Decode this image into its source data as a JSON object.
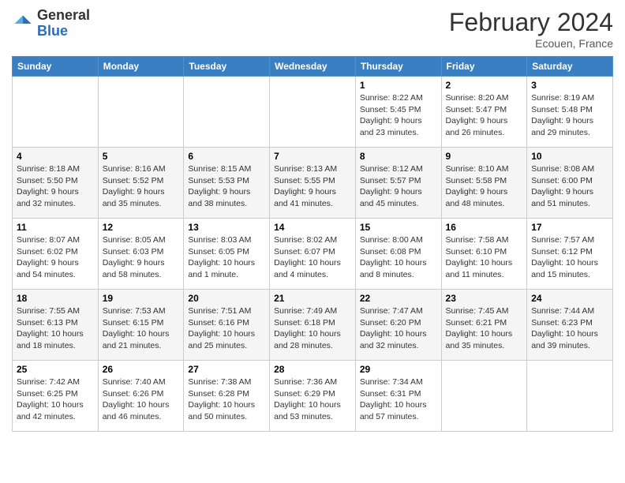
{
  "header": {
    "logo_general": "General",
    "logo_blue": "Blue",
    "month_title": "February 2024",
    "location": "Ecouen, France"
  },
  "days_of_week": [
    "Sunday",
    "Monday",
    "Tuesday",
    "Wednesday",
    "Thursday",
    "Friday",
    "Saturday"
  ],
  "weeks": [
    [
      {
        "day": "",
        "info": ""
      },
      {
        "day": "",
        "info": ""
      },
      {
        "day": "",
        "info": ""
      },
      {
        "day": "",
        "info": ""
      },
      {
        "day": "1",
        "info": "Sunrise: 8:22 AM\nSunset: 5:45 PM\nDaylight: 9 hours\nand 23 minutes."
      },
      {
        "day": "2",
        "info": "Sunrise: 8:20 AM\nSunset: 5:47 PM\nDaylight: 9 hours\nand 26 minutes."
      },
      {
        "day": "3",
        "info": "Sunrise: 8:19 AM\nSunset: 5:48 PM\nDaylight: 9 hours\nand 29 minutes."
      }
    ],
    [
      {
        "day": "4",
        "info": "Sunrise: 8:18 AM\nSunset: 5:50 PM\nDaylight: 9 hours\nand 32 minutes."
      },
      {
        "day": "5",
        "info": "Sunrise: 8:16 AM\nSunset: 5:52 PM\nDaylight: 9 hours\nand 35 minutes."
      },
      {
        "day": "6",
        "info": "Sunrise: 8:15 AM\nSunset: 5:53 PM\nDaylight: 9 hours\nand 38 minutes."
      },
      {
        "day": "7",
        "info": "Sunrise: 8:13 AM\nSunset: 5:55 PM\nDaylight: 9 hours\nand 41 minutes."
      },
      {
        "day": "8",
        "info": "Sunrise: 8:12 AM\nSunset: 5:57 PM\nDaylight: 9 hours\nand 45 minutes."
      },
      {
        "day": "9",
        "info": "Sunrise: 8:10 AM\nSunset: 5:58 PM\nDaylight: 9 hours\nand 48 minutes."
      },
      {
        "day": "10",
        "info": "Sunrise: 8:08 AM\nSunset: 6:00 PM\nDaylight: 9 hours\nand 51 minutes."
      }
    ],
    [
      {
        "day": "11",
        "info": "Sunrise: 8:07 AM\nSunset: 6:02 PM\nDaylight: 9 hours\nand 54 minutes."
      },
      {
        "day": "12",
        "info": "Sunrise: 8:05 AM\nSunset: 6:03 PM\nDaylight: 9 hours\nand 58 minutes."
      },
      {
        "day": "13",
        "info": "Sunrise: 8:03 AM\nSunset: 6:05 PM\nDaylight: 10 hours\nand 1 minute."
      },
      {
        "day": "14",
        "info": "Sunrise: 8:02 AM\nSunset: 6:07 PM\nDaylight: 10 hours\nand 4 minutes."
      },
      {
        "day": "15",
        "info": "Sunrise: 8:00 AM\nSunset: 6:08 PM\nDaylight: 10 hours\nand 8 minutes."
      },
      {
        "day": "16",
        "info": "Sunrise: 7:58 AM\nSunset: 6:10 PM\nDaylight: 10 hours\nand 11 minutes."
      },
      {
        "day": "17",
        "info": "Sunrise: 7:57 AM\nSunset: 6:12 PM\nDaylight: 10 hours\nand 15 minutes."
      }
    ],
    [
      {
        "day": "18",
        "info": "Sunrise: 7:55 AM\nSunset: 6:13 PM\nDaylight: 10 hours\nand 18 minutes."
      },
      {
        "day": "19",
        "info": "Sunrise: 7:53 AM\nSunset: 6:15 PM\nDaylight: 10 hours\nand 21 minutes."
      },
      {
        "day": "20",
        "info": "Sunrise: 7:51 AM\nSunset: 6:16 PM\nDaylight: 10 hours\nand 25 minutes."
      },
      {
        "day": "21",
        "info": "Sunrise: 7:49 AM\nSunset: 6:18 PM\nDaylight: 10 hours\nand 28 minutes."
      },
      {
        "day": "22",
        "info": "Sunrise: 7:47 AM\nSunset: 6:20 PM\nDaylight: 10 hours\nand 32 minutes."
      },
      {
        "day": "23",
        "info": "Sunrise: 7:45 AM\nSunset: 6:21 PM\nDaylight: 10 hours\nand 35 minutes."
      },
      {
        "day": "24",
        "info": "Sunrise: 7:44 AM\nSunset: 6:23 PM\nDaylight: 10 hours\nand 39 minutes."
      }
    ],
    [
      {
        "day": "25",
        "info": "Sunrise: 7:42 AM\nSunset: 6:25 PM\nDaylight: 10 hours\nand 42 minutes."
      },
      {
        "day": "26",
        "info": "Sunrise: 7:40 AM\nSunset: 6:26 PM\nDaylight: 10 hours\nand 46 minutes."
      },
      {
        "day": "27",
        "info": "Sunrise: 7:38 AM\nSunset: 6:28 PM\nDaylight: 10 hours\nand 50 minutes."
      },
      {
        "day": "28",
        "info": "Sunrise: 7:36 AM\nSunset: 6:29 PM\nDaylight: 10 hours\nand 53 minutes."
      },
      {
        "day": "29",
        "info": "Sunrise: 7:34 AM\nSunset: 6:31 PM\nDaylight: 10 hours\nand 57 minutes."
      },
      {
        "day": "",
        "info": ""
      },
      {
        "day": "",
        "info": ""
      }
    ]
  ]
}
